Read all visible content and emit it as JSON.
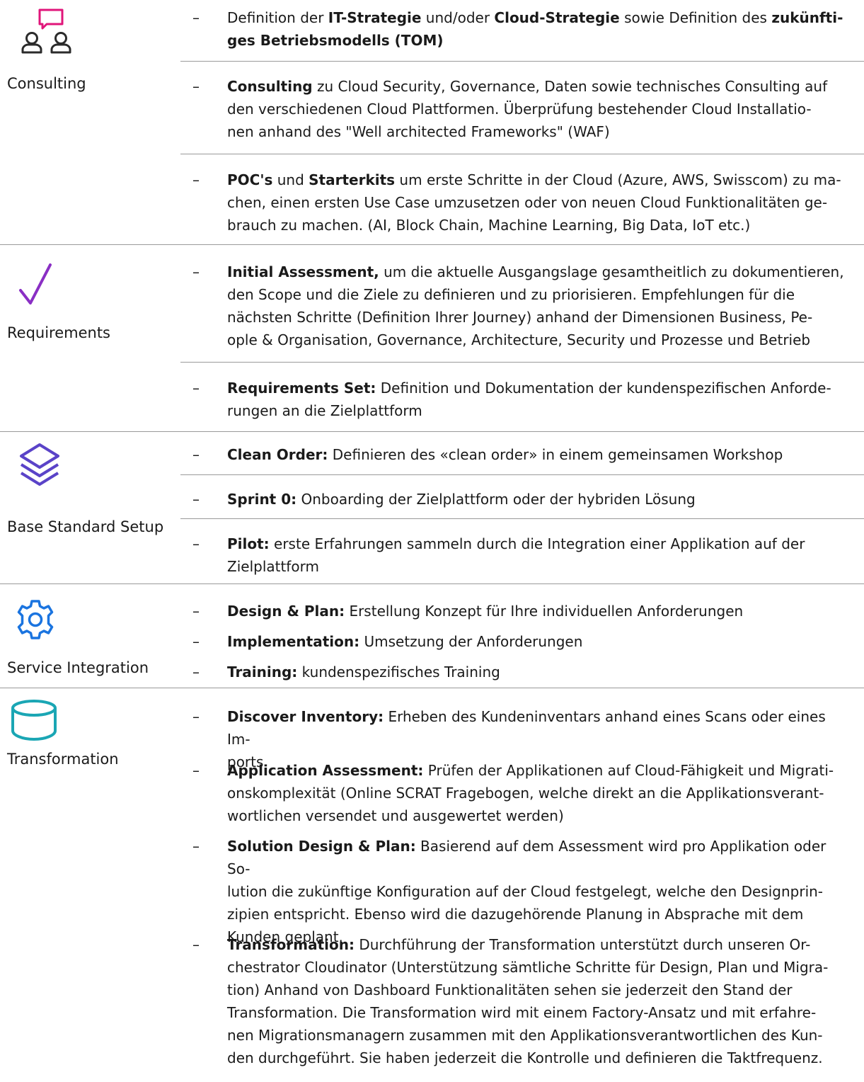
{
  "colors": {
    "consulting_icon_pink": "#e0157a",
    "icon_dark": "#2b2b2b",
    "requirements_icon": "#8a2fc4",
    "layers_icon": "#5a43c8",
    "gear_icon": "#1a74e0",
    "database_icon": "#1aa6b4",
    "divider": "#9a9a9a"
  },
  "sections": {
    "consulting": {
      "label": "Consulting",
      "icon": "people-chat-icon",
      "items": [
        {
          "p1": "Definition der ",
          "b1": "IT-Strategie",
          "p2": " und/oder ",
          "b2": "Cloud-Strategie",
          "p3": " sowie Definition des ",
          "b3": "zukünfti-"
        },
        {
          "b1": "Consulting",
          "p1": " zu Cloud Security, Governance, Daten sowie technisches Consulting auf",
          "l2": "den verschiedenen Cloud Plattformen. Überprüfung bestehender Cloud Installatio-",
          "l3": "nen anhand des \"Well architected Frameworks\" (WAF)"
        },
        {
          "b1": "POC's",
          "p1": " und ",
          "b2": "Starterkits",
          "p2": " um erste Schritte in der Cloud (Azure, AWS, Swisscom) zu ma-",
          "l2": "chen, einen ersten Use Case umzusetzen oder von neuen Cloud Funktionalitäten ge-",
          "l3": "brauch zu machen. (AI, Block Chain, Machine Learning, Big Data, IoT etc.)"
        }
      ],
      "item1_line2": "ges Betriebsmodells (TOM)"
    },
    "requirements": {
      "label": "Requirements",
      "icon": "checkmark-icon",
      "items": [
        {
          "b1": "Initial Assessment,",
          "p1": " um die aktuelle Ausgangslage gesamtheitlich zu dokumentieren,",
          "l2": "den Scope und die Ziele zu definieren und zu priorisieren. Empfehlungen für die",
          "l3": "nächsten Schritte (Definition Ihrer Journey) anhand der Dimensionen Business, Pe-",
          "l4": "ople & Organisation, Governance, Architecture, Security und Prozesse und Betrieb"
        },
        {
          "b1": "Requirements Set:",
          "p1": " Definition und Dokumentation der kundenspezifischen Anforde-",
          "l2": "rungen an die Zielplattform"
        }
      ]
    },
    "base": {
      "label": "Base Standard Setup",
      "icon": "layers-icon",
      "items": [
        {
          "b1": "Clean Order:",
          "p1": " Definieren des «clean order» in einem gemeinsamen Workshop"
        },
        {
          "b1": "Sprint 0:",
          "p1": " Onboarding der Zielplattform oder der hybriden Lösung"
        },
        {
          "b1": "Pilot:",
          "p1": " erste Erfahrungen sammeln durch die Integration einer Applikation auf der",
          "l2": "Zielplattform"
        }
      ]
    },
    "service": {
      "label": "Service Integration",
      "icon": "gear-icon",
      "items": [
        {
          "b1": "Design & Plan:",
          "p1": " Erstellung Konzept für Ihre individuellen Anforderungen"
        },
        {
          "b1": "Implementation:",
          "p1": " Umsetzung der Anforderungen"
        },
        {
          "b1": "Training:",
          "p1": " kundenspezifisches Training"
        }
      ]
    },
    "transformation": {
      "label": "Transformation",
      "icon": "database-icon",
      "items": [
        {
          "b1": "Discover Inventory:",
          "p1": " Erheben des Kundeninventars anhand eines Scans oder eines Im-",
          "l2": "ports"
        },
        {
          "b1": "Application Assessment:",
          "p1": " Prüfen der Applikationen auf Cloud-Fähigkeit und Migrati-",
          "l2": "onskomplexität (Online SCRAT Fragebogen, welche direkt an die Applikationsverant-",
          "l3": "wortlichen versendet und ausgewertet werden)"
        },
        {
          "b1": "Solution Design & Plan:",
          "p1": " Basierend auf dem Assessment wird pro Applikation oder So-",
          "l2": "lution die zukünftige Konfiguration auf der Cloud festgelegt, welche den Designprin-",
          "l3": "zipien entspricht. Ebenso wird die dazugehörende Planung in Absprache mit dem",
          "l4": "Kunden geplant."
        },
        {
          "b1": "Transformation:",
          "p1": " Durchführung der Transformation unterstützt durch unseren Or-",
          "l2": "chestrator Cloudinator (Unterstützung sämtliche Schritte für Design, Plan und Migra-",
          "l3": "tion) Anhand von Dashboard Funktionalitäten sehen sie jederzeit den Stand der",
          "l4": "Transformation. Die Transformation wird mit einem Factory-Ansatz und mit erfahre-",
          "l5": "nen Migrationsmanagern zusammen mit den Applikationsverantwortlichen des Kun-",
          "l6": "den durchgeführt. Sie haben jederzeit die Kontrolle und definieren die Taktfrequenz."
        }
      ]
    },
    "dash": "–"
  }
}
